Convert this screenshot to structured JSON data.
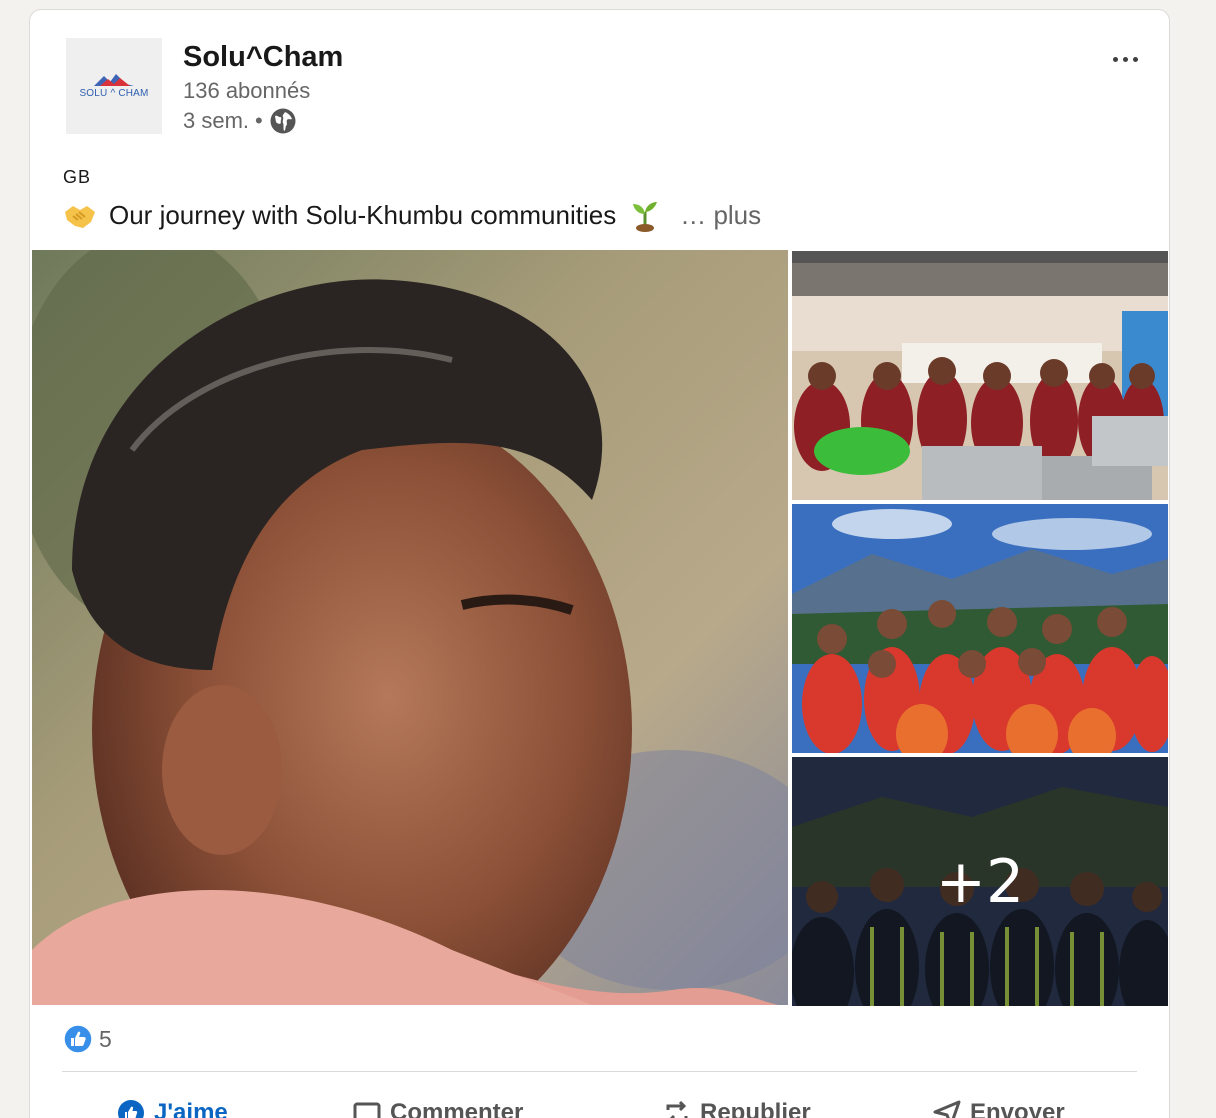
{
  "post": {
    "author": {
      "name": "Solu^Cham",
      "logo_text": "SOLU ^ CHAM",
      "followers": "136 abonnés",
      "time": "3 sem.",
      "separator": "•",
      "visibility_icon": "globe-icon"
    },
    "menu_icon": "more-horizontal-icon",
    "tag": "GB",
    "text": "Our journey with Solu-Khumbu communities",
    "text_emoji_left": "handshake-icon",
    "text_emoji_right": "seedling-icon",
    "more_link": "… plus",
    "gallery": {
      "images": [
        {
          "description_icon": "child-portrait-photo"
        },
        {
          "description_icon": "kitchen-group-photo"
        },
        {
          "description_icon": "dancers-group-photo"
        },
        {
          "description_icon": "boys-group-photo"
        }
      ],
      "extra_count": "+2"
    },
    "reactions": {
      "icon": "like-reaction-icon",
      "count": "5"
    },
    "actions": [
      {
        "label": "J'aime",
        "icon": "thumbs-up-icon"
      },
      {
        "label": "Commenter",
        "icon": "comment-icon"
      },
      {
        "label": "Republier",
        "icon": "repost-icon"
      },
      {
        "label": "Envoyer",
        "icon": "send-icon"
      }
    ],
    "colors": {
      "accent": "#0a66c2",
      "background": "#f4f2ee",
      "card": "#ffffff",
      "muted_text": "#666666"
    }
  }
}
